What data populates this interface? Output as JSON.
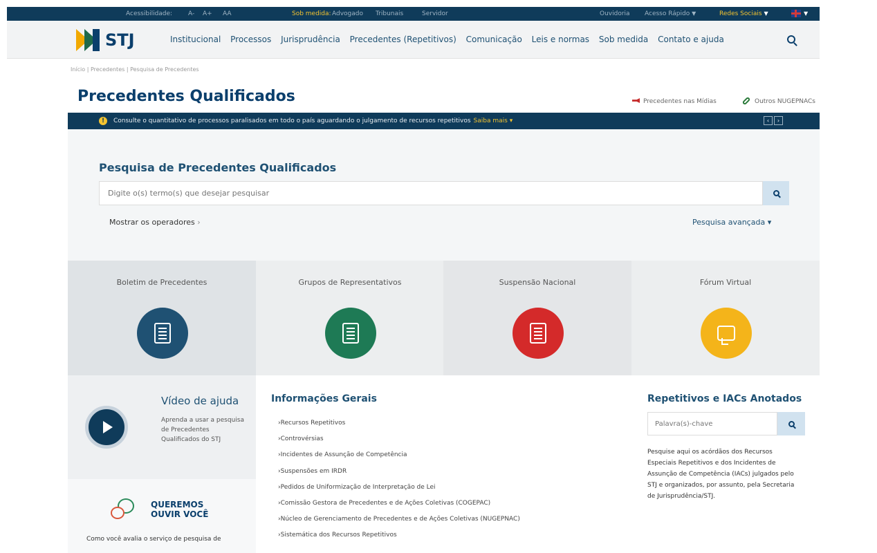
{
  "topbar": {
    "acessibilidade": "Acessibilidade:",
    "font_a_minus": "A-",
    "font_a_plus": "A+",
    "font_aa": "AA",
    "sob_medida": "Sob medida:",
    "advogado": "Advogado",
    "tribunais": "Tribunais",
    "servidor": "Servidor",
    "ouvidoria": "Ouvidoria",
    "acesso_rapido": "Acesso Rápido",
    "redes_sociais": "Redes Sociais"
  },
  "header": {
    "logo_text": "STJ",
    "nav": [
      "Institucional",
      "Processos",
      "Jurisprudência",
      "Precedentes (Repetitivos)",
      "Comunicação",
      "Leis e normas",
      "Sob medida",
      "Contato e ajuda"
    ]
  },
  "breadcrumb": "Início | Precedentes | Pesquisa de Precedentes",
  "page_title": "Precedentes Qualificados",
  "links_right": {
    "midias": "Precedentes nas Mídias",
    "nugepnacs": "Outros NUGEPNACs"
  },
  "alert": {
    "message": "Consulte o quantitativo de processos paralisados em todo o país aguardando o julgamento de recursos repetitivos",
    "saiba_mais": "Saiba mais"
  },
  "search": {
    "title": "Pesquisa de Precedentes Qualificados",
    "placeholder": "Digite o(s) termo(s) que desejar pesquisar",
    "show_operators": "Mostrar os operadores",
    "advanced": "Pesquisa avançada"
  },
  "tiles": [
    {
      "label": "Boletim de Precedentes",
      "color": "#1f5173",
      "bg": "#dfe3e6"
    },
    {
      "label": "Grupos de Representativos",
      "color": "#1e7a55",
      "bg": "#eceeef"
    },
    {
      "label": "Suspensão Nacional",
      "color": "#d42a2a",
      "bg": "#e4e6e8"
    },
    {
      "label": "Fórum Virtual",
      "color": "#f4b41a",
      "bg": "#eceeef"
    }
  ],
  "video": {
    "title": "Vídeo de ajuda",
    "description": "Aprenda a usar a pesquisa de Precedentes Qualificados do STJ"
  },
  "queremos": {
    "title_line1": "QUEREMOS",
    "title_line2": "OUVIR VOCÊ",
    "description": "Como você avalia o serviço de pesquisa de"
  },
  "info": {
    "title": "Informações Gerais",
    "items": [
      "Recursos Repetitivos",
      "Controvérsias",
      "Incidentes de Assunção de Competência",
      "Suspensões em IRDR",
      "Pedidos de Uniformização de Interpretação de Lei",
      "Comissão Gestora de Precedentes e de Ações Coletivas (COGEPAC)",
      "Núcleo de Gerenciamento de Precedentes e de Ações Coletivas (NUGEPNAC)",
      "Sistemática dos Recursos Repetitivos"
    ]
  },
  "repetitivos": {
    "title": "Repetitivos e IACs Anotados",
    "placeholder": "Palavra(s)-chave",
    "description": "Pesquise aqui os acórdãos dos Recursos Especiais Repetitivos e dos Incidentes de Assunção de Competência (IACs) julgados pelo STJ e organizados, por assunto, pela Secretaria de Jurisprudência/STJ."
  },
  "colors": {
    "primary": "#0b3f6c",
    "topbar": "#0f3b5a",
    "accent_yellow": "#f4c430"
  }
}
